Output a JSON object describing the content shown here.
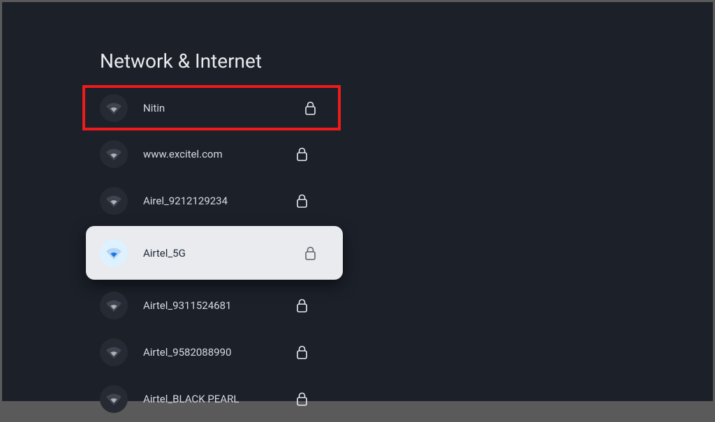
{
  "page": {
    "title": "Network & Internet"
  },
  "networks": [
    {
      "name": "Nitin",
      "secured": true,
      "highlighted": true,
      "focused": false
    },
    {
      "name": "www.excitel.com",
      "secured": true,
      "highlighted": false,
      "focused": false
    },
    {
      "name": "Airel_9212129234",
      "secured": true,
      "highlighted": false,
      "focused": false
    },
    {
      "name": "Airtel_5G",
      "secured": true,
      "highlighted": false,
      "focused": true
    },
    {
      "name": "Airtel_9311524681",
      "secured": true,
      "highlighted": false,
      "focused": false
    },
    {
      "name": "Airtel_9582088990",
      "secured": true,
      "highlighted": false,
      "focused": false
    },
    {
      "name": "Airtel_BLACK PEARL",
      "secured": true,
      "highlighted": false,
      "focused": false
    }
  ]
}
